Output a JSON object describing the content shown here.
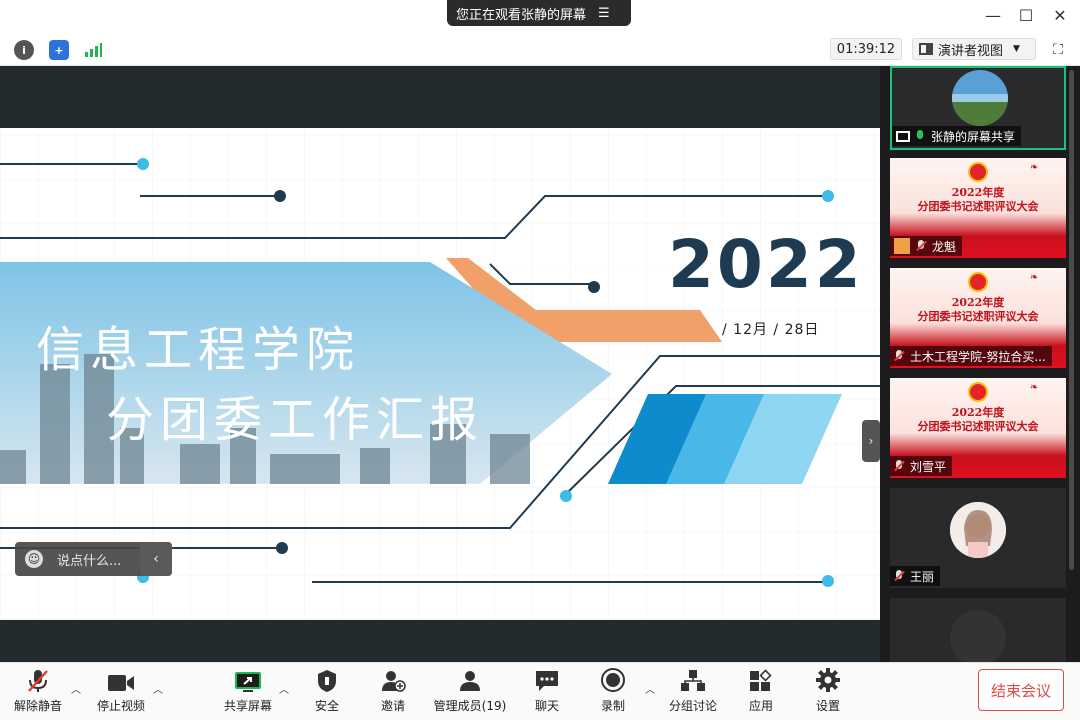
{
  "titlebar": {
    "share_banner": "您正在观看张静的屏幕",
    "menu_icon": "list-icon",
    "window_controls": [
      "minimize-icon",
      "maximize-icon",
      "close-icon"
    ]
  },
  "infobar": {
    "icons": [
      "info-icon",
      "shield-icon",
      "signal-icon"
    ],
    "timer": "01:39:12",
    "view_mode": "演讲者视图",
    "fullscreen_icon": "fullscreen-icon"
  },
  "slide": {
    "title_line1": "信息工程学院",
    "title_line2": "分团委工作汇报",
    "year": "2022",
    "date": "/ 12月 / 28日",
    "colors": {
      "navy": "#1f3b52",
      "orange": "#f0a068",
      "cyan": "#3bbde8",
      "blue": "#0e8bcd"
    }
  },
  "chat": {
    "placeholder": "说点什么..."
  },
  "participants": [
    {
      "name": "张静的屏幕共享",
      "type": "screen-share",
      "active": true
    },
    {
      "name": "龙魁",
      "type": "poster",
      "poster_line1": "2022年度",
      "poster_line2": "分团委书记述职评议大会"
    },
    {
      "name": "土木工程学院-努拉合买...",
      "type": "poster",
      "poster_line1": "2022年度",
      "poster_line2": "分团委书记述职评议大会"
    },
    {
      "name": "刘雪平",
      "type": "poster",
      "poster_line1": "2022年度",
      "poster_line2": "分团委书记述职评议大会"
    },
    {
      "name": "王丽",
      "type": "avatar"
    }
  ],
  "toolbar": {
    "unmute": "解除静音",
    "stop_video": "停止视频",
    "share_screen": "共享屏幕",
    "security": "安全",
    "invite": "邀请",
    "manage_members": "管理成员(19)",
    "chat": "聊天",
    "record": "录制",
    "breakout": "分组讨论",
    "apps": "应用",
    "settings": "设置",
    "end_meeting": "结束会议"
  }
}
